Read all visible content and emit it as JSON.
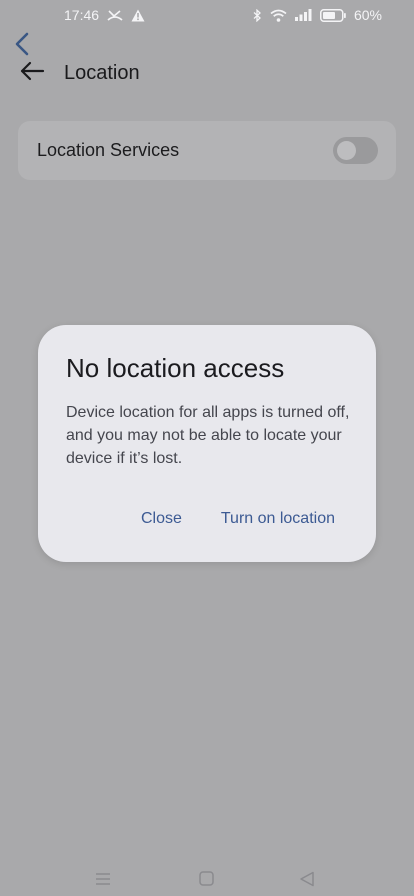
{
  "status_bar": {
    "time": "17:46",
    "battery_percent": "60%",
    "icons": [
      "missed-call-icon",
      "warning-icon",
      "bluetooth-icon",
      "wifi-icon",
      "signal-icon",
      "battery-icon"
    ]
  },
  "header": {
    "title": "Location"
  },
  "settings": {
    "location_services_label": "Location Services",
    "location_services_enabled": false
  },
  "dialog": {
    "title": "No location access",
    "message": "Device location for all apps is turned off, and you may not be able to locate your device if it’s lost.",
    "close_label": "Close",
    "turn_on_label": "Turn on location"
  },
  "colors": {
    "scrim_background": "#a9a9ab",
    "dialog_background": "#e8e8ed",
    "accent": "#3c5a93"
  }
}
